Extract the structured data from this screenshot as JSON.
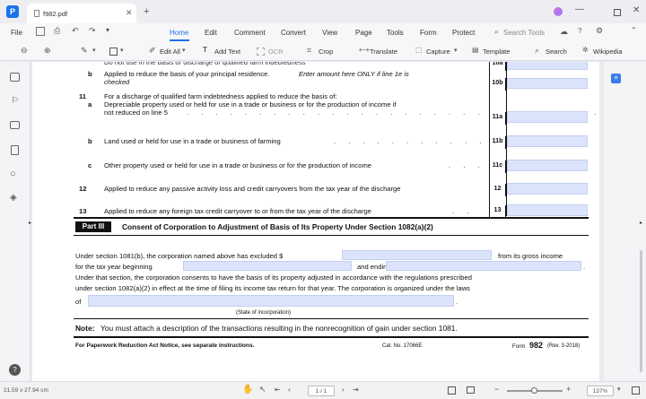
{
  "app": {
    "tab_title": "f982.pdf",
    "brand_color": "#1a73e8"
  },
  "menu": {
    "file": "File",
    "items": [
      "Home",
      "Edit",
      "Comment",
      "Convert",
      "View",
      "Page",
      "Tools",
      "Form",
      "Protect"
    ],
    "active": "Home",
    "search_placeholder": "Search Tools"
  },
  "toolbar": {
    "edit_all": "Edit All",
    "add_text": "Add Text",
    "ocr": "OCR",
    "crop": "Crop",
    "translate": "Translate",
    "capture": "Capture",
    "template": "Template",
    "search": "Search",
    "wikipedia": "Wikipedia"
  },
  "form": {
    "row10b": {
      "letter": "b",
      "text1": "Applied to reduce the basis of your principal residence.",
      "text1b": "Enter amount here ONLY if line 1e is",
      "text2": "checked",
      "no": "10b"
    },
    "row10a_no": "10a",
    "row11": {
      "num": "11",
      "letter": "a",
      "text1": "For a discharge of qualified farm indebtedness applied to reduce the basis of:",
      "text2": "Depreciable property used or held for use in a trade or business or for the production of income if",
      "text3": "not reduced on line 5",
      "no": "11a"
    },
    "row11b": {
      "letter": "b",
      "text": "Land used or held for use in a trade or business of farming",
      "no": "11b"
    },
    "row11c": {
      "letter": "c",
      "text": "Other property used or held for use in a trade or business or for the production of income",
      "no": "11c"
    },
    "row12": {
      "num": "12",
      "text": "Applied to reduce any passive activity loss and credit carryovers from the tax year of the discharge",
      "no": "12"
    },
    "row13": {
      "num": "13",
      "text": "Applied to reduce any foreign tax credit carryover to or from the tax year of the discharge",
      "no": "13"
    },
    "part3": {
      "tag": "Part III",
      "title": "Consent of Corporation to Adjustment of Basis of Its Property Under Section 1082(a)(2)"
    },
    "consent": {
      "l1a": "Under section 1081(b), the corporation named above has excluded $",
      "l1b": "from its gross income",
      "l2a": "for the tax year beginning",
      "l2b": "and ending",
      "l3": "Under that section, the corporation consents to have the basis of its property adjusted in accordance with the regulations prescribed",
      "l4": "under section 1082(a)(2) in effect at the time of filing its income tax return for that year. The corporation is organized under the laws",
      "l5": "of",
      "state_caption": "(State of incorporation)"
    },
    "note_label": "Note:",
    "note_text": "You must attach a description of the transactions resulting in the nonrecognition of gain under section 1081.",
    "footer_left": "For Paperwork Reduction Act Notice, see separate instructions.",
    "footer_cat": "Cat. No. 17066E",
    "footer_form": "Form",
    "footer_formno": "982",
    "footer_rev": "(Rev. 3-2018)"
  },
  "status": {
    "dimensions": "21.59 x 27.94 cm",
    "page_indicator": "1 / 1",
    "zoom": "137%"
  }
}
